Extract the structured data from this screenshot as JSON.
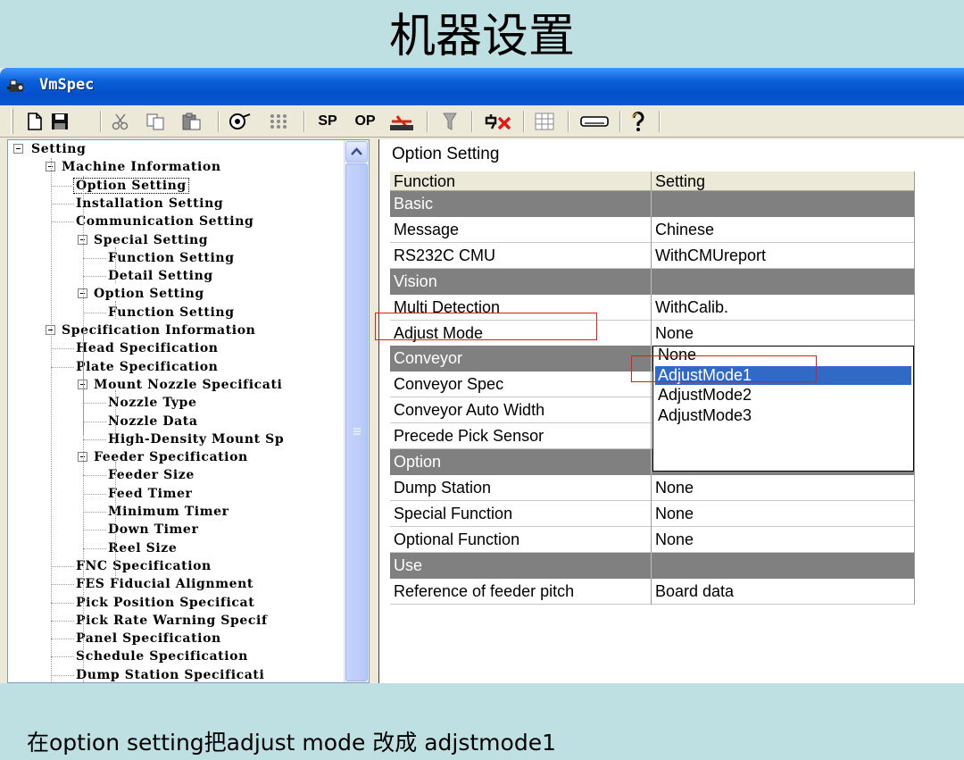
{
  "slide": {
    "title": "机器设置",
    "caption": "在option setting把adjust mode 改成 adjstmode1"
  },
  "window": {
    "title": "VmSpec",
    "icon": "app-icon"
  },
  "toolbar": {
    "items": [
      {
        "name": "new-file-icon"
      },
      {
        "name": "save-icon"
      },
      {
        "name": "cut-icon"
      },
      {
        "name": "copy-icon"
      },
      {
        "name": "paste-icon"
      },
      {
        "name": "reel-icon"
      },
      {
        "name": "grid-dots-icon"
      },
      {
        "name": "sp-button",
        "label": "SP"
      },
      {
        "name": "op-button",
        "label": "OP"
      },
      {
        "name": "transfer-icon"
      },
      {
        "name": "filter-icon"
      },
      {
        "name": "delete-machine-icon"
      },
      {
        "name": "table-icon"
      },
      {
        "name": "panel-icon"
      },
      {
        "name": "help-icon"
      }
    ]
  },
  "tree": {
    "items": [
      {
        "label": "Setting",
        "level": 0,
        "toggle": true
      },
      {
        "label": "Machine Information",
        "level": 1,
        "toggle": true
      },
      {
        "label": "Option Setting",
        "level": 2,
        "selected": true
      },
      {
        "label": "Installation Setting",
        "level": 2
      },
      {
        "label": "Communication Setting",
        "level": 2
      },
      {
        "label": "Special Setting",
        "level": 2,
        "toggle": true
      },
      {
        "label": "Function Setting",
        "level": 3
      },
      {
        "label": "Detail Setting",
        "level": 3
      },
      {
        "label": "Option Setting",
        "level": 2,
        "toggle": true
      },
      {
        "label": "Function Setting",
        "level": 3
      },
      {
        "label": "Specification Information",
        "level": 1,
        "toggle": true
      },
      {
        "label": "Head Specification",
        "level": 2
      },
      {
        "label": "Plate Specification",
        "level": 2
      },
      {
        "label": "Mount Nozzle Specificati",
        "level": 2,
        "toggle": true
      },
      {
        "label": "Nozzle Type",
        "level": 3
      },
      {
        "label": "Nozzle Data",
        "level": 3
      },
      {
        "label": "High-Density Mount Sp",
        "level": 3
      },
      {
        "label": "Feeder Specification",
        "level": 2,
        "toggle": true
      },
      {
        "label": "Feeder Size",
        "level": 3
      },
      {
        "label": "Feed Timer",
        "level": 3
      },
      {
        "label": "Minimum Timer",
        "level": 3
      },
      {
        "label": "Down Timer",
        "level": 3
      },
      {
        "label": "Reel Size",
        "level": 3
      },
      {
        "label": "FNC Specification",
        "level": 2
      },
      {
        "label": "FES Fiducial Alignment",
        "level": 2
      },
      {
        "label": "Pick Position Specificat",
        "level": 2
      },
      {
        "label": "Pick Rate Warning Specif",
        "level": 2
      },
      {
        "label": "Panel Specification",
        "level": 2
      },
      {
        "label": "Schedule Specification",
        "level": 2
      },
      {
        "label": "Dump Station Specificati",
        "level": 2
      }
    ]
  },
  "grid": {
    "title": "Option Setting",
    "headers": [
      "Function",
      "Setting"
    ],
    "rows": [
      {
        "type": "section",
        "function": "Basic",
        "setting": ""
      },
      {
        "type": "row",
        "function": "Message",
        "setting": "Chinese"
      },
      {
        "type": "row",
        "function": "RS232C CMU",
        "setting": "WithCMUreport"
      },
      {
        "type": "section",
        "function": "Vision",
        "setting": ""
      },
      {
        "type": "row",
        "function": "Multi Detection",
        "setting": "WithCalib."
      },
      {
        "type": "row",
        "function": "Adjust Mode",
        "setting": "None"
      },
      {
        "type": "section",
        "function": "Conveyor",
        "setting": ""
      },
      {
        "type": "row",
        "function": "Conveyor Spec",
        "setting": ""
      },
      {
        "type": "row",
        "function": "Conveyor Auto Width",
        "setting": ""
      },
      {
        "type": "row",
        "function": "Precede Pick Sensor",
        "setting": ""
      },
      {
        "type": "section",
        "function": "Option",
        "setting": ""
      },
      {
        "type": "row",
        "function": "Dump Station",
        "setting": "None"
      },
      {
        "type": "row",
        "function": "Special Function",
        "setting": "None"
      },
      {
        "type": "row",
        "function": "Optional Function",
        "setting": "None"
      },
      {
        "type": "section",
        "function": "Use",
        "setting": ""
      },
      {
        "type": "row",
        "function": "Reference of feeder pitch",
        "setting": "Board data"
      }
    ]
  },
  "dropdown": {
    "options": [
      "None",
      "AdjustMode1",
      "AdjustMode2",
      "AdjustMode3"
    ],
    "selected_index": 1,
    "highlight_color": "#316ac5"
  },
  "annotation_color": "#e31b1b"
}
